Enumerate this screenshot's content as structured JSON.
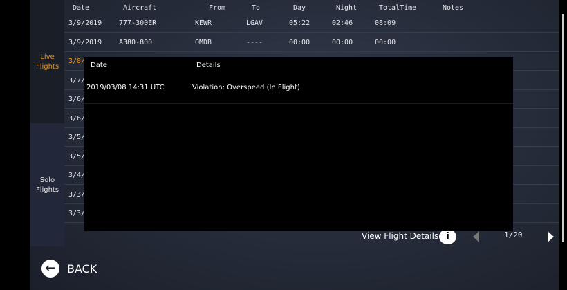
{
  "sidebar": {
    "live": "Live\nFlights",
    "solo": "Solo\nFlights"
  },
  "table": {
    "headers": [
      "Date",
      "Aircraft",
      "From",
      "To",
      "Day",
      "Night",
      "TotalTime",
      "Notes"
    ],
    "rows": [
      [
        "3/9/2019",
        "777-300ER",
        "KEWR",
        "LGAV",
        "05:22",
        "02:46",
        "08:09",
        ""
      ],
      [
        "3/9/2019",
        "A380-800",
        "OMDB",
        "----",
        "00:00",
        "00:00",
        "00:00",
        ""
      ]
    ],
    "partial_dates": [
      "3/8/",
      "3/7/",
      "3/6/",
      "3/6/",
      "3/5/",
      "3/5/",
      "3/4/",
      "3/3/",
      "3/3/"
    ]
  },
  "popup": {
    "headers": [
      "Date",
      "Details"
    ],
    "rows": [
      [
        "2019/03/08 14:31 UTC",
        "Violation: Overspeed (In Flight)"
      ]
    ]
  },
  "footer": {
    "view_details": "View Flight Details",
    "page": "1/20",
    "back": "BACK",
    "info_icon_text": "i"
  }
}
